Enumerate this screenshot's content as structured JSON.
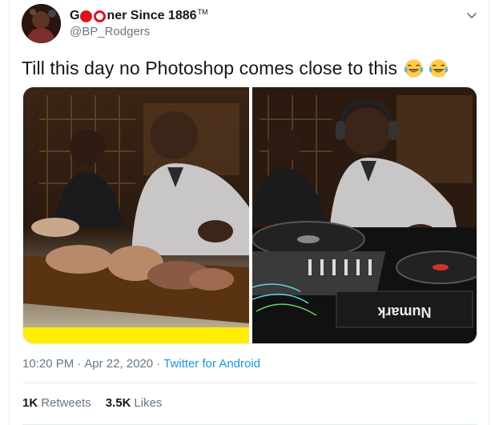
{
  "author": {
    "name_prefix": "G",
    "name_suffix": "ner Since 1886",
    "trademark": "TM",
    "handle": "@BP_Rodgers",
    "logo_color": "#d8161b"
  },
  "tweet": {
    "text": "Till this day no Photoshop comes close to this",
    "emojis": [
      "face-with-tears-of-joy",
      "face-with-tears-of-joy"
    ]
  },
  "media": {
    "left_photo_caption": "",
    "right_photo_brand_text": "Numark"
  },
  "meta": {
    "time": "10:20 PM",
    "separator": "·",
    "date": "Apr 22, 2020",
    "source": "Twitter for Android"
  },
  "stats": {
    "retweets_count": "1K",
    "retweets_label": "Retweets",
    "likes_count": "3.5K",
    "likes_label": "Likes"
  },
  "colors": {
    "link": "#1b95e0",
    "secondary_text": "#657786",
    "border": "#e6ecf0"
  }
}
